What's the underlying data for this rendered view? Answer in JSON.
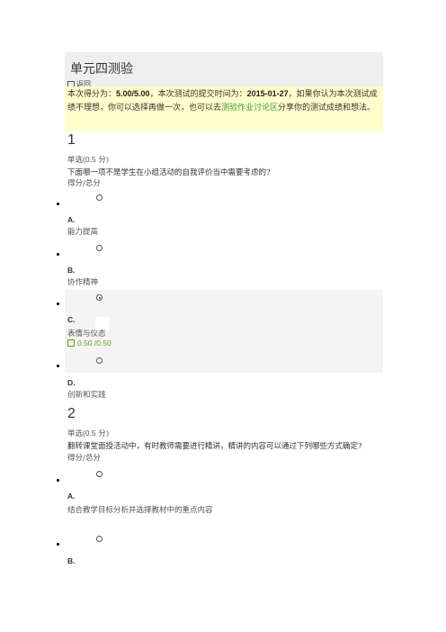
{
  "header": {
    "title": "单元四测验",
    "back_label": "返回"
  },
  "notice": {
    "p1": "本次得分为：",
    "score": "5.00/5.00",
    "p2": "，本次测试的提交时间为：",
    "date": "2015-01-27",
    "p3": "，如果你认为本次测试成绩不理想，你可以选择再做一次，也可以去",
    "link": "测验作业讨论区",
    "p4": "分享你的测试成绩和想法。"
  },
  "questions": [
    {
      "number": "1",
      "type_prefix": "单选",
      "type_points": "(0.5",
      "type_suffix": " 分)",
      "text": "下面哪一项不是学生在小组活动的自我评价当中需要考虑的?",
      "score_label": "得分/总分",
      "options": [
        {
          "letter": "A.",
          "text": "能力提高",
          "selected": false
        },
        {
          "letter": "B.",
          "text": "协作精神",
          "selected": false
        },
        {
          "letter": "C.",
          "text": "表情与仪态",
          "selected": true,
          "score": "0.50 /0.50"
        },
        {
          "letter": "D.",
          "text": "创新和实践",
          "selected": false
        }
      ]
    },
    {
      "number": "2",
      "type_prefix": "单选",
      "type_points": "(0.5",
      "type_suffix": " 分)",
      "text": "翻转课堂面授活动中，有时教师需要进行精讲，精讲的内容可以通过下列哪些方式确定?",
      "score_label": "得分/总分",
      "options": [
        {
          "letter": "A.",
          "text": "结合教学目标分析并选择教材中的重点内容",
          "selected": false
        },
        {
          "letter": "B.",
          "text": "",
          "selected": false
        }
      ]
    }
  ]
}
